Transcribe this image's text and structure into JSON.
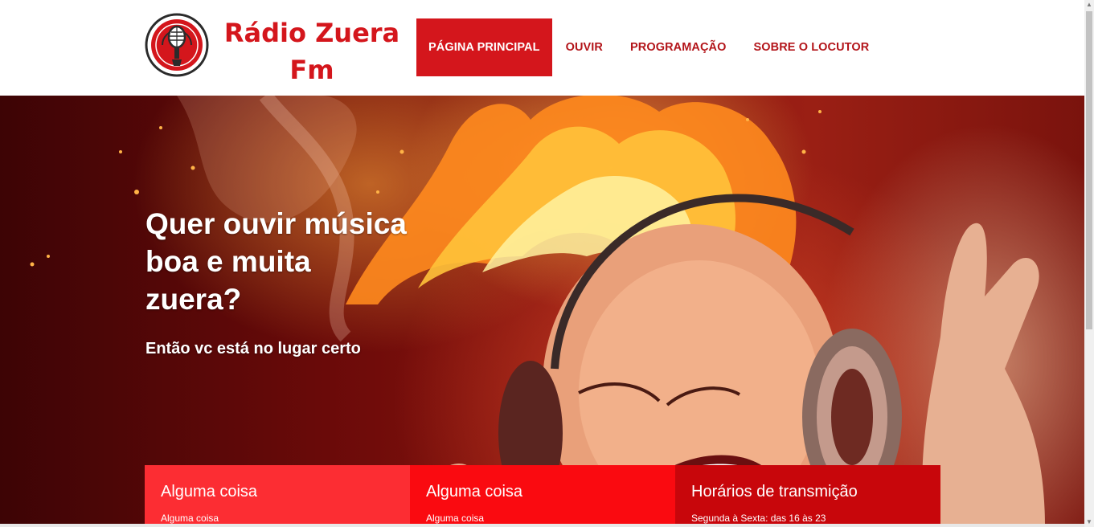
{
  "brand": {
    "line1": "Rádio Zuera",
    "line2": "Fm",
    "logo_icon": "microphone-icon",
    "color": "#d4161c"
  },
  "nav": {
    "items": [
      {
        "label": "PÁGINA PRINCIPAL",
        "active": true
      },
      {
        "label": "OUVIR",
        "active": false
      },
      {
        "label": "PROGRAMAÇÃO",
        "active": false
      },
      {
        "label": "SOBRE O LOCUTOR",
        "active": false
      }
    ]
  },
  "hero": {
    "title_line1": "Quer ouvir música",
    "title_line2": "boa e muita",
    "title_line3": "zuera?",
    "subtitle": "Então vc está no lugar certo"
  },
  "cards": [
    {
      "title": "Alguma coisa",
      "text": "Alguma coisa",
      "color": "#fc2d33"
    },
    {
      "title": "Alguma coisa",
      "text": "Alguma coisa",
      "color": "#fa0a10"
    },
    {
      "title": "Horários de transmição",
      "text": "Segunda à Sexta: das 16 às 23",
      "color": "#c8060b"
    }
  ]
}
